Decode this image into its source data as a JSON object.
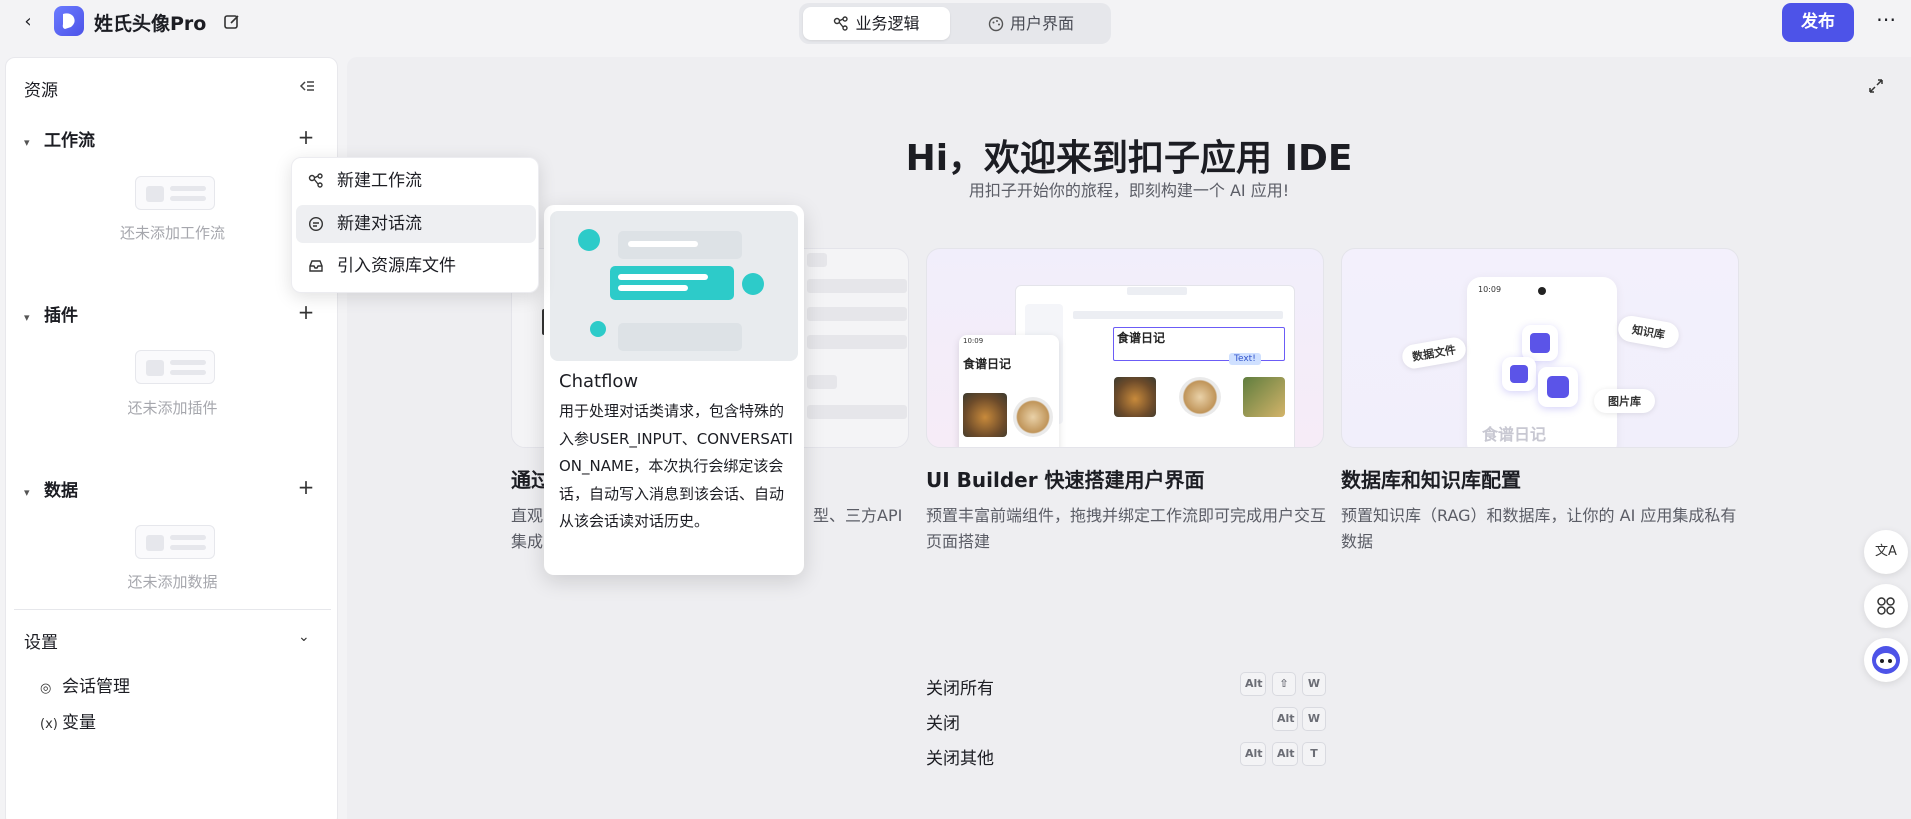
{
  "header": {
    "app_title": "姓氏头像Pro",
    "tabs": [
      {
        "label": "业务逻辑",
        "active": true,
        "icon": "workflow-icon"
      },
      {
        "label": "用户界面",
        "active": false,
        "icon": "palette-icon"
      }
    ],
    "publish_label": "发布"
  },
  "sidebar": {
    "title": "资源",
    "sections": [
      {
        "label": "工作流",
        "empty_text": "还未添加工作流"
      },
      {
        "label": "插件",
        "empty_text": "还未添加插件"
      },
      {
        "label": "数据",
        "empty_text": "还未添加数据"
      }
    ],
    "settings": {
      "label": "设置",
      "items": [
        {
          "label": "会话管理",
          "icon": "chat-settings-icon"
        },
        {
          "label": "变量",
          "icon": "variable-icon"
        }
      ]
    }
  },
  "dropdown": {
    "items": [
      {
        "label": "新建工作流",
        "icon": "workflow-icon"
      },
      {
        "label": "新建对话流",
        "icon": "chatflow-icon",
        "highlighted": true
      },
      {
        "label": "引入资源库文件",
        "icon": "library-icon"
      }
    ]
  },
  "main": {
    "hero_title": "Hi，欢迎来到扣子应用 IDE",
    "hero_subtitle": "用扣子开始你的旅程，即刻构建一个 AI 应用!",
    "cards": [
      {
        "title_visible": "通过",
        "desc_line1_start": "直观",
        "desc_line1_end": "型、三方API",
        "desc_line2_start": "集成"
      },
      {
        "title": "UI Builder 快速搭建用户界面",
        "desc": "预置丰富前端组件，拖拽并绑定工作流即可完成用户交互页面搭建",
        "preview_heading": "食谱日记",
        "preview_badge": "Text!",
        "preview_status": "10:09"
      },
      {
        "title": "数据库和知识库配置",
        "desc": "预置知识库（RAG）和数据库，让你的 AI 应用集成私有数据",
        "chips": [
          "数据文件",
          "知识库",
          "图片库"
        ],
        "preview_heading": "食谱日记",
        "preview_status": "10:09"
      }
    ],
    "tooltip": {
      "title": "Chatflow",
      "desc": "用于处理对话类请求，包含特殊的入参USER_INPUT、CONVERSATION_NAME，本次执行会绑定该会话，自动写入消息到该会话、自动从该会话读对话历史。"
    },
    "shortcuts": [
      {
        "label": "关闭所有",
        "keys": [
          "Alt",
          "⇧",
          "W"
        ]
      },
      {
        "label": "关闭",
        "keys": [
          "Alt",
          "W"
        ]
      },
      {
        "label": "关闭其他",
        "keys": [
          "Alt",
          "Alt",
          "T"
        ]
      }
    ]
  },
  "floating": {
    "buttons": [
      "translate-icon",
      "apps-grid-icon",
      "assistant-bot-icon"
    ],
    "translate_label": "文A"
  },
  "colors": {
    "accent": "#4d53e8",
    "chatflow_teal": "#2dcbc9"
  }
}
